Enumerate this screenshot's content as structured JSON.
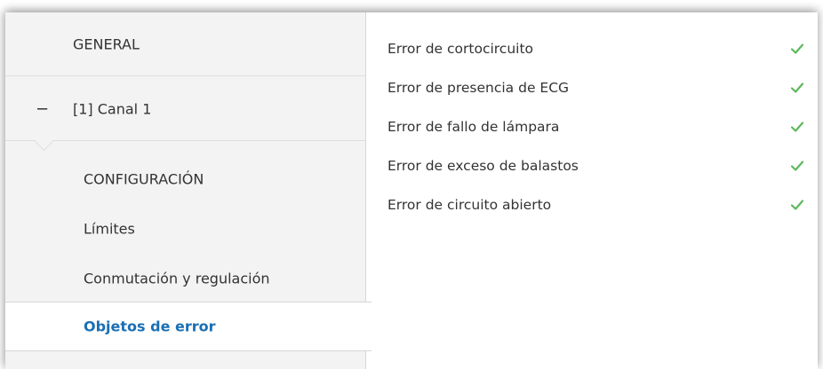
{
  "sidebar": {
    "general": "GENERAL",
    "canal": {
      "collapse_symbol": "−",
      "label": "[1] Canal 1"
    },
    "sub_items": [
      {
        "label": "CONFIGURACIÓN"
      },
      {
        "label": "Límites"
      },
      {
        "label": "Conmutación y regulación"
      },
      {
        "label": "Objetos de error",
        "selected": true
      }
    ]
  },
  "error_objects": [
    {
      "label": "Error de cortocircuito",
      "checked": true
    },
    {
      "label": "Error de presencia de ECG",
      "checked": true
    },
    {
      "label": "Error de fallo de lámpara",
      "checked": true
    },
    {
      "label": "Error de exceso de balastos",
      "checked": true
    },
    {
      "label": "Error de circuito abierto",
      "checked": true
    }
  ],
  "colors": {
    "selected_text": "#1a6fb3",
    "check": "#5cb85c",
    "sidebar_bg": "#f3f3f3"
  },
  "icons": {
    "check": "check-icon",
    "collapse": "collapse-icon"
  }
}
